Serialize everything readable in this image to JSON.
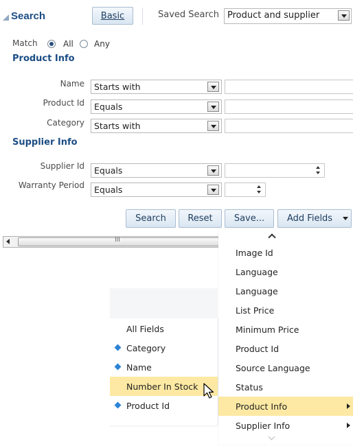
{
  "header": {
    "title": "Search",
    "basic_label": "Basic",
    "saved_search_label": "Saved Search",
    "saved_search_value": "Product and supplier"
  },
  "match": {
    "label": "Match",
    "all": "All",
    "any": "Any",
    "selected": "All"
  },
  "product_info": {
    "title": "Product Info",
    "rows": [
      {
        "label": "Name",
        "operator": "Starts with"
      },
      {
        "label": "Product Id",
        "operator": "Equals"
      },
      {
        "label": "Category",
        "operator": "Starts with"
      }
    ]
  },
  "supplier_info": {
    "title": "Supplier Info",
    "rows": [
      {
        "label": "Supplier Id",
        "operator": "Equals"
      },
      {
        "label": "Warranty Period",
        "operator": "Equals"
      }
    ]
  },
  "actions": {
    "search": "Search",
    "reset": "Reset",
    "save": "Save...",
    "add_fields": "Add Fields"
  },
  "scrollbar": {
    "grip": "III"
  },
  "add_fields_menu": {
    "items": [
      "Image Id",
      "Language",
      "Language",
      "List Price",
      "Minimum Price",
      "Product Id",
      "Source Language",
      "Status",
      "Product Info",
      "Supplier Info"
    ],
    "highlighted": "Product Info"
  },
  "product_info_submenu": {
    "items": [
      {
        "label": "All Fields",
        "selected": false
      },
      {
        "label": "Category",
        "selected": true
      },
      {
        "label": "Name",
        "selected": true
      },
      {
        "label": "Number In Stock",
        "selected": false
      },
      {
        "label": "Product Id",
        "selected": true
      }
    ],
    "highlighted": "Number In Stock"
  },
  "colors": {
    "accent": "#1b4d84",
    "highlight": "#fde9a3",
    "selected_marker": "#2d83d6"
  }
}
